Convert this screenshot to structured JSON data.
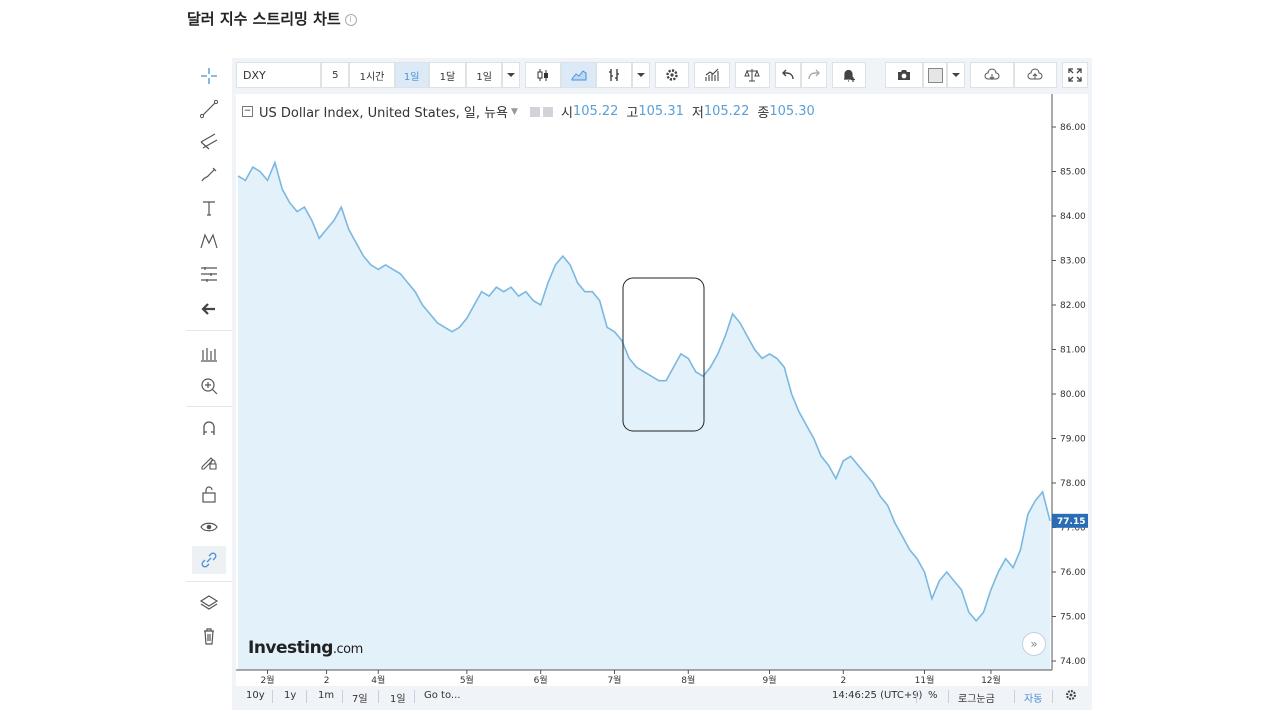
{
  "page": {
    "title": "달러 지수 스트리밍 차트",
    "info_glyph": "i"
  },
  "toolbar": {
    "symbol": "DXY",
    "intervals": [
      "5",
      "1시간",
      "1일",
      "1달",
      "1일"
    ],
    "selected_interval": "1일"
  },
  "legend": {
    "name": "US Dollar Index, United States, 일, 뉴욕",
    "open_label": "시",
    "open": "105.22",
    "high_label": "고",
    "high": "105.31",
    "low_label": "저",
    "low": "105.22",
    "close_label": "종",
    "close": "105.30"
  },
  "logo": {
    "brand": "Investing",
    "suffix": ".com"
  },
  "bottom_bar": {
    "ranges": [
      "10y",
      "1y",
      "1m",
      "7일",
      "1일"
    ],
    "goto": "Go to...",
    "time": "14:46:25 (UTC+9)",
    "percent": "%",
    "log": "로그눈금",
    "auto": "자동"
  },
  "colors": {
    "line": "#7bb8e0",
    "fill": "#e3f1fa",
    "price_tag": "#2a6db5",
    "accent": "#4a90d9"
  },
  "icons": [
    "crosshair-icon",
    "trendline-icon",
    "pitchfork-icon",
    "brush-icon",
    "text-icon",
    "pattern-icon",
    "measure-icon",
    "back-arrow-icon",
    "indicators-icon",
    "zoom-icon",
    "magnet-icon",
    "lock-draw-icon",
    "unlock-icon",
    "eye-icon",
    "link-icon",
    "layers-icon",
    "trash-icon"
  ],
  "chart_data": {
    "type": "area",
    "last_price_label": "77.15",
    "ylim": [
      74,
      86
    ],
    "yticks": [
      "74.00",
      "75.00",
      "76.00",
      "77.00",
      "78.00",
      "79.00",
      "80.00",
      "81.00",
      "82.00",
      "83.00",
      "84.00",
      "85.00",
      "86.00"
    ],
    "xticks": [
      {
        "label": "2월",
        "i": 4
      },
      {
        "label": "2",
        "i": 12
      },
      {
        "label": "4월",
        "i": 19
      },
      {
        "label": "5월",
        "i": 31
      },
      {
        "label": "6월",
        "i": 41
      },
      {
        "label": "7월",
        "i": 51
      },
      {
        "label": "8월",
        "i": 61
      },
      {
        "label": "9월",
        "i": 72
      },
      {
        "label": "2",
        "i": 82
      },
      {
        "label": "11월",
        "i": 93
      },
      {
        "label": "12월",
        "i": 102
      }
    ],
    "values": [
      84.9,
      84.8,
      85.1,
      85.0,
      84.8,
      85.2,
      84.6,
      84.3,
      84.1,
      84.2,
      83.9,
      83.5,
      83.7,
      83.9,
      84.2,
      83.7,
      83.4,
      83.1,
      82.9,
      82.8,
      82.9,
      82.8,
      82.7,
      82.5,
      82.3,
      82.0,
      81.8,
      81.6,
      81.5,
      81.4,
      81.5,
      81.7,
      82.0,
      82.3,
      82.2,
      82.4,
      82.3,
      82.4,
      82.2,
      82.3,
      82.1,
      82.0,
      82.5,
      82.9,
      83.1,
      82.9,
      82.5,
      82.3,
      82.3,
      82.1,
      81.5,
      81.4,
      81.2,
      80.8,
      80.6,
      80.5,
      80.4,
      80.3,
      80.3,
      80.6,
      80.9,
      80.8,
      80.5,
      80.4,
      80.6,
      80.9,
      81.3,
      81.8,
      81.6,
      81.3,
      81.0,
      80.8,
      80.9,
      80.8,
      80.6,
      80.0,
      79.6,
      79.3,
      79.0,
      78.6,
      78.4,
      78.1,
      78.5,
      78.6,
      78.4,
      78.2,
      78.0,
      77.7,
      77.5,
      77.1,
      76.8,
      76.5,
      76.3,
      76.0,
      75.4,
      75.8,
      76.0,
      75.8,
      75.6,
      75.1,
      74.9,
      75.1,
      75.6,
      76.0,
      76.3,
      76.1,
      76.5,
      77.3,
      77.6,
      77.8,
      77.15
    ]
  }
}
